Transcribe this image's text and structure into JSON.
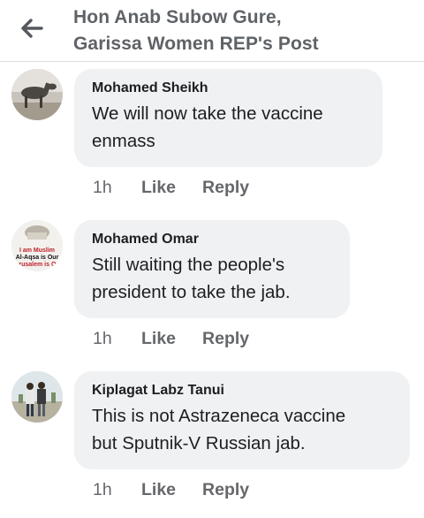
{
  "header": {
    "back_icon": "arrow-left-icon",
    "title_line1": "Hon Anab Subow Gure,",
    "title_line2": "Garissa Women REP's Post"
  },
  "comments": [
    {
      "avatar": "donkey-photo",
      "author": "Mohamed Sheikh",
      "text_line1": "We will now take the vaccine",
      "text_line2": "enmass",
      "time": "1h",
      "like": "Like",
      "reply": "Reply"
    },
    {
      "avatar": "mosque-sticker-photo",
      "avatar_text": [
        "I am Muslim",
        "Al-Aqsa is Our",
        "Jerusalem is Our"
      ],
      "author": "Mohamed Omar",
      "text_line1": "Still waiting the people's",
      "text_line2": "president to take the jab.",
      "time": "1h",
      "like": "Like",
      "reply": "Reply"
    },
    {
      "avatar": "people-outdoors-photo",
      "author": "Kiplagat Labz Tanui",
      "text_line1": "This is not Astrazeneca vaccine",
      "text_line2": "but Sputnik-V Russian jab.",
      "time": "1h",
      "like": "Like",
      "reply": "Reply"
    }
  ],
  "colors": {
    "bubble": "#eff1f3",
    "meta_text": "#65676b",
    "header_text": "#5f6367"
  }
}
